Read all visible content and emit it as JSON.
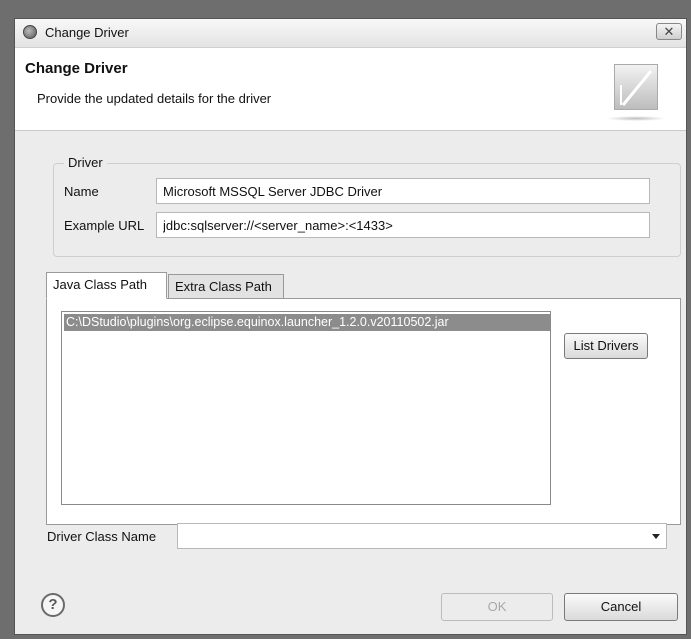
{
  "window": {
    "title": "Change Driver",
    "close_glyph": "✕",
    "icon": "app-globe-icon"
  },
  "header": {
    "title": "Change Driver",
    "subtitle": "Provide the updated details for the driver",
    "logo": "wizard-banner-icon"
  },
  "driver_group": {
    "label": "Driver",
    "name_label": "Name",
    "name_value": "Microsoft MSSQL Server JDBC Driver",
    "url_label": "Example URL",
    "url_value": "jdbc:sqlserver://<server_name>:<1433>"
  },
  "tabs": [
    {
      "label": "Java Class Path",
      "active": true
    },
    {
      "label": "Extra Class Path",
      "active": false
    }
  ],
  "class_path": {
    "items": [
      "C:\\DStudio\\plugins\\org.eclipse.equinox.launcher_1.2.0.v20110502.jar"
    ],
    "selected_index": 0,
    "list_drivers_label": "List Drivers"
  },
  "driver_class": {
    "label": "Driver Class Name",
    "value": ""
  },
  "footer": {
    "help_glyph": "?",
    "ok_label": "OK",
    "ok_enabled": false,
    "cancel_label": "Cancel"
  }
}
